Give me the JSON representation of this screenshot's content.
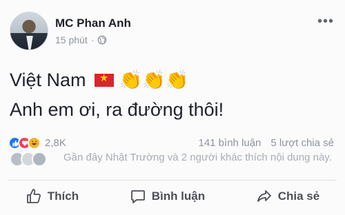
{
  "post": {
    "author": "MC Phan Anh",
    "time": "15 phút",
    "separator": "·",
    "line1_text": "Việt Nam",
    "line2_text": "Anh em ơi, ra đường thôi!",
    "emoji_clap": "👏"
  },
  "reactions": {
    "count": "2,8K",
    "comments": "141 bình luận",
    "shares": "5 lượt chia sẻ"
  },
  "friends": {
    "text": "Gần đây Nhật Trường và 2 người khác thích nội dung này."
  },
  "actions": {
    "like": "Thích",
    "comment": "Bình luận",
    "share": "Chia sẻ"
  },
  "colors": {
    "like_blue": "#1877f2",
    "love_red": "#f33e58",
    "haha_yellow": "#f7b125",
    "flag_red": "#d8262a",
    "flag_star": "#f7d100"
  }
}
